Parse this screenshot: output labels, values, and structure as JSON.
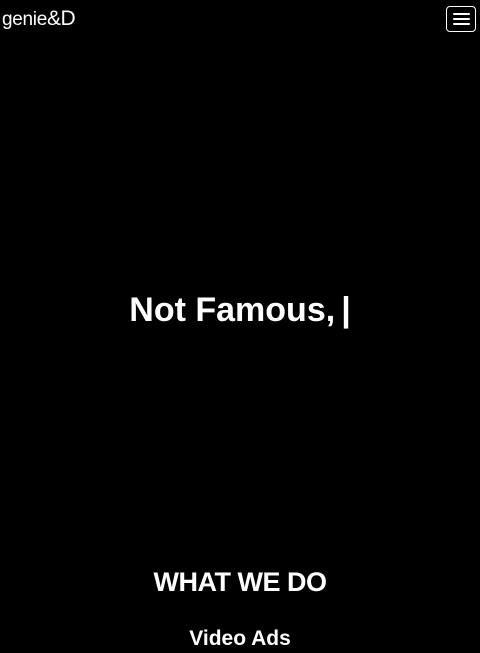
{
  "header": {
    "logo_main": "genie",
    "logo_amp": "&D",
    "menu_icon": "hamburger-menu-icon"
  },
  "hero": {
    "headline": "Not Famous,",
    "cursor": "|"
  },
  "what_we_do": {
    "title": "WHAT WE DO",
    "items": [
      {
        "label": "Video Ads"
      }
    ]
  },
  "colors": {
    "background": "#000000",
    "text": "#ffffff"
  }
}
